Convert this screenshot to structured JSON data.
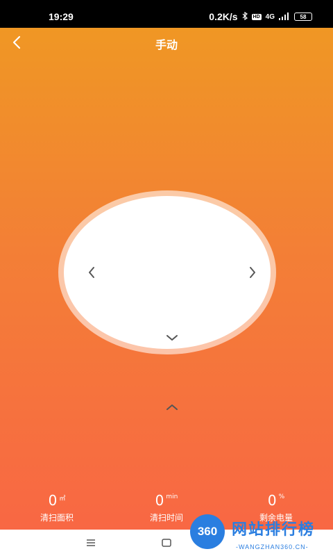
{
  "status_bar": {
    "time": "19:29",
    "network_speed": "0.2K/s",
    "hd_label": "HD",
    "signal_label": "4G",
    "battery": "58"
  },
  "header": {
    "title": "手动",
    "back_icon": "chevron-left-icon"
  },
  "dpad": {
    "up_icon": "chevron-up-icon",
    "down_icon": "chevron-down-icon",
    "left_icon": "chevron-left-icon",
    "right_icon": "chevron-right-icon"
  },
  "stats": [
    {
      "value": "0",
      "unit": "㎡",
      "label": "清扫面积"
    },
    {
      "value": "0",
      "unit": "min",
      "label": "清扫时间"
    },
    {
      "value": "0",
      "unit": "%",
      "label": "剩余电量"
    }
  ],
  "watermark": {
    "logo_text": "360",
    "title": "网站排行榜",
    "subtitle": "-WANGZHAN360.CN-"
  },
  "colors": {
    "gradient_top": "#ef9a22",
    "gradient_bottom": "#f96545",
    "watermark": "#2a7ee0"
  }
}
